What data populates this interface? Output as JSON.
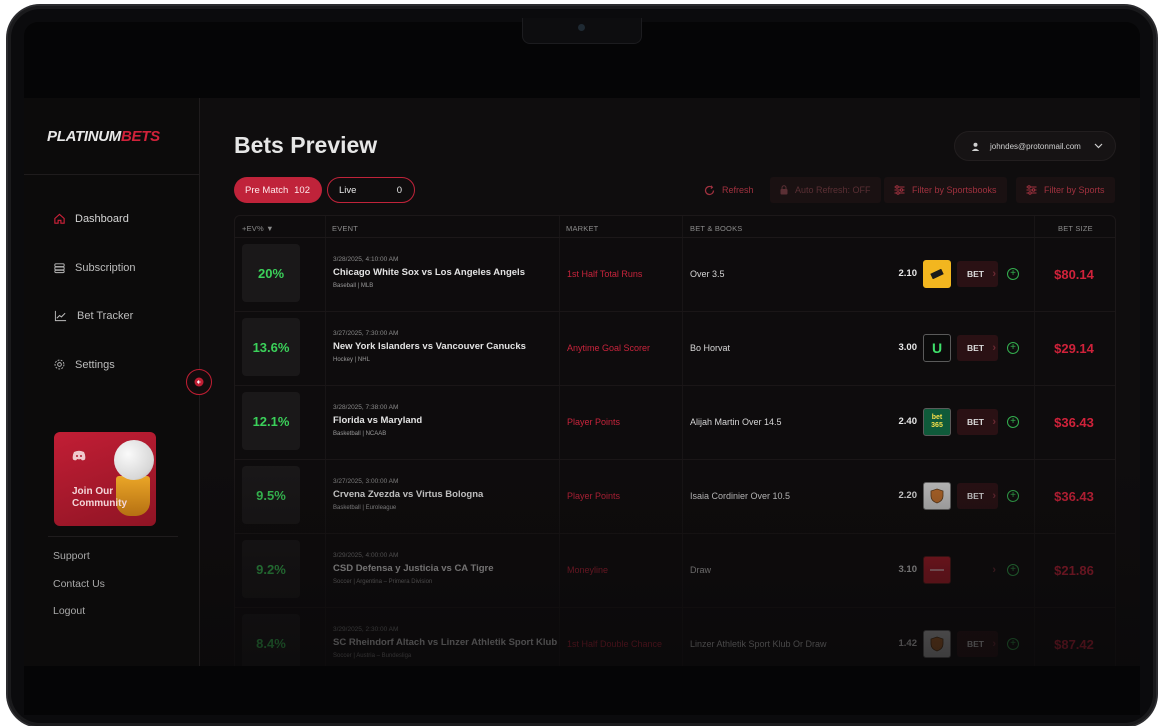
{
  "brand": {
    "part1": "PLATINUM",
    "part2": "BETS"
  },
  "page": {
    "title": "Bets Preview"
  },
  "user": {
    "email": "johndes@protonmail.com"
  },
  "sidebar": {
    "items": [
      {
        "label": "Dashboard",
        "icon": "home-icon"
      },
      {
        "label": "Subscription",
        "icon": "coins-icon"
      },
      {
        "label": "Bet Tracker",
        "icon": "chart-icon"
      },
      {
        "label": "Settings",
        "icon": "gear-icon"
      }
    ],
    "community": "Join Our Community",
    "footer": [
      "Support",
      "Contact Us",
      "Logout"
    ]
  },
  "tabs": [
    {
      "label": "Pre Match",
      "count": "102"
    },
    {
      "label": "Live",
      "count": "0"
    }
  ],
  "toolbar": {
    "refresh": "Refresh",
    "auto_refresh": "Auto Refresh: OFF",
    "filter_books": "Filter by Sportsbooks",
    "filter_sports": "Filter by Sports"
  },
  "table": {
    "headers": {
      "ev": "+EV% ▼",
      "event": "EVENT",
      "market": "MARKET",
      "bet_books": "BET & BOOKS",
      "bet_size": "BET SIZE"
    },
    "rows": [
      {
        "ev": "20%",
        "date": "3/28/2025, 4:10:00 AM",
        "event": "Chicago White Sox vs Los Angeles Angels",
        "league": "Baseball | MLB",
        "market": "1st Half Total Runs",
        "bet": "Over 3.5",
        "odds": "2.10",
        "book": "yellow-book",
        "bet_label": "BET",
        "size": "$80.14"
      },
      {
        "ev": "13.6%",
        "date": "3/27/2025, 7:30:00 AM",
        "event": "New York Islanders vs Vancouver Canucks",
        "league": "Hockey | NHL",
        "market": "Anytime Goal Scorer",
        "bet": "Bo Horvat",
        "odds": "3.00",
        "book": "unibet-book",
        "bet_label": "BET",
        "size": "$29.14"
      },
      {
        "ev": "12.1%",
        "date": "3/28/2025, 7:38:00 AM",
        "event": "Florida vs Maryland",
        "league": "Basketball | NCAAB",
        "market": "Player Points",
        "bet": "Alijah Martin Over 14.5",
        "odds": "2.40",
        "book": "bet365-book",
        "bet_label": "BET",
        "size": "$36.43"
      },
      {
        "ev": "9.5%",
        "date": "3/27/2025, 3:00:00 AM",
        "event": "Crvena Zvezda vs Virtus Bologna",
        "league": "Basketball | Euroleague",
        "market": "Player Points",
        "bet": "Isaia Cordinier Over 10.5",
        "odds": "2.20",
        "book": "shield-book",
        "bet_label": "BET",
        "size": "$36.43"
      },
      {
        "ev": "9.2%",
        "date": "3/29/2025, 4:00:00 AM",
        "event": "CSD Defensa y Justicia vs CA Tigre",
        "league": "Soccer | Argentina – Primera Division",
        "market": "Moneyline",
        "bet": "Draw",
        "odds": "3.10",
        "book": "red-book",
        "bet_label": "",
        "size": "$21.86"
      },
      {
        "ev": "8.4%",
        "date": "3/29/2025, 2:30:00 AM",
        "event": "SC Rheindorf Altach vs Linzer Athletik Sport Klub",
        "league": "Soccer | Austria – Bundesliga",
        "market": "1st Half Double Chance",
        "bet": "Linzer Athletik Sport Klub Or Draw",
        "odds": "1.42",
        "book": "shield-book",
        "bet_label": "BET",
        "size": "$87.42"
      }
    ]
  },
  "colors": {
    "accent": "#c0233a",
    "positive": "#3bd15a",
    "background": "#0f0d0e"
  }
}
